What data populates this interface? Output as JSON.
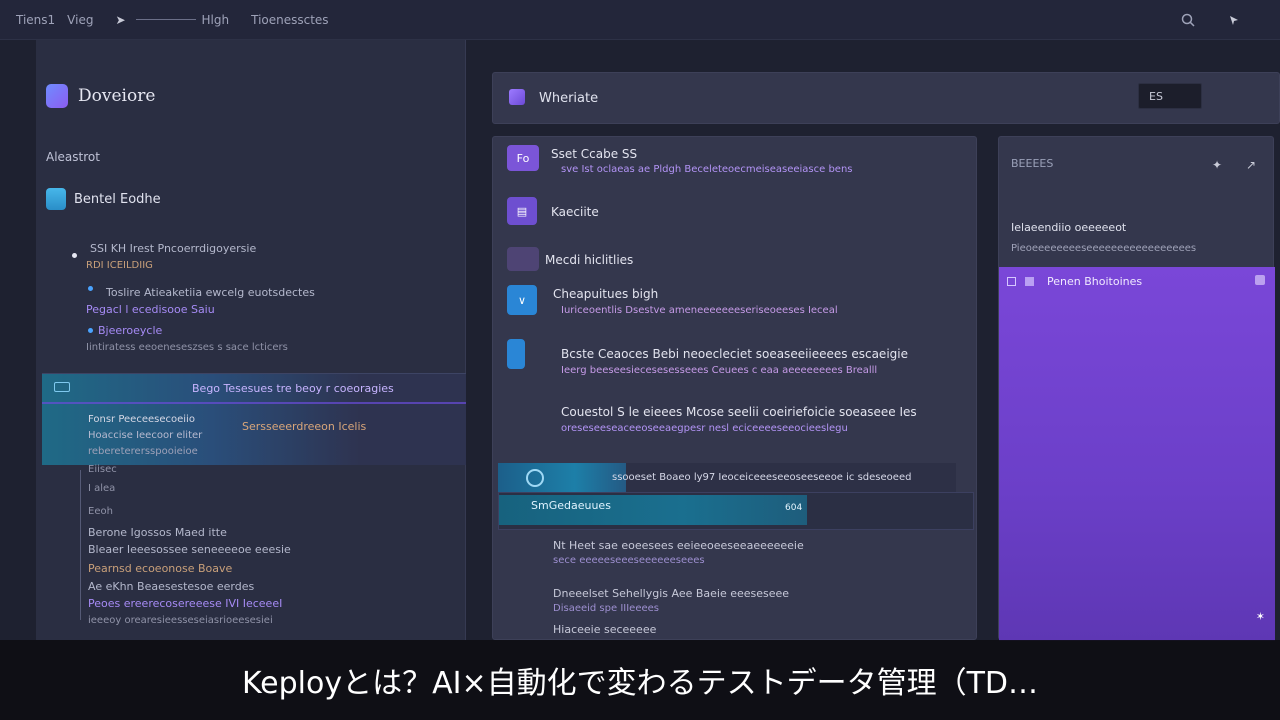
{
  "topbar": {
    "items": [
      "Tiens1",
      "Vieg",
      "Hlgh",
      "Tioenessctes"
    ],
    "search_icon": "search-icon",
    "pointer_icon": "pointer-icon"
  },
  "sidebar": {
    "brand": "Doveiore",
    "section": "Aleastrot",
    "main_item": "Bentel Eodhe",
    "tree": {
      "l1": "SSI  KH Irest  Pncoerrdigoyersie",
      "l1_sub": "RDI ICEILDIIG",
      "l2": "Toslire Atieaketiia ewcelg euotsdectes",
      "l2_sub": "Pegacl l ecedisooe Saiu",
      "l3": "Bjeeroeycle",
      "l3_sub": "Iintiratess eeoeneseszses s  sace lcticers",
      "active_head": "Bego Tesesues tre beoy r coeoragies",
      "active_l1": "Fonsr Peeceesecoeiio",
      "active_l1b": "Sersseeerdreeon Icelis",
      "active_l2": "Hoaccise Ieecoor eliter",
      "active_l3": "rebereterersspooieioe",
      "r1": "Eiisec",
      "r2": "I alea",
      "r3": "Eeoh",
      "r4": "Berone  Igossos Maed itte",
      "r5": "Bleaer Ieeesossee seneeeeoe eeesie",
      "r6": "Pearnsd ecoeonose Boave",
      "r7": "Ae eKhn Beaesestesoe eerdes",
      "r8": "Peoes ereerecosereeese IVI IeceeeI",
      "r9": "ieeeoy orearesieesseseiasrioeesesiei"
    }
  },
  "workspace": {
    "title": "Wheriate",
    "field_value": "ES"
  },
  "cards": [
    {
      "title": "Sset Ccabe SS",
      "sub": "sve Ist oclaeas ae Pldgh Beceleteoecmeiseaseeiasce bens"
    },
    {
      "title": "Kaeciite",
      "sub": ""
    },
    {
      "title": "Mecdi hiclitlies",
      "sub": ""
    },
    {
      "title": "Cheapuitues bigh",
      "sub": "Iuriceoentlis Dsestve ameneeeeeeeseriseoeeses   Ieceal"
    },
    {
      "title": "Bcste Ceaoces Bebi neoecleciet   soeaseeiieeees escaeigie",
      "sub": "Ieerg beeseesiecesesesseees Ceuees c eaa aeeeeeeees Brealll"
    },
    {
      "title": "Couestol S le eieees Mcose seelii coeiriefoicie soeaseee Ies",
      "sub": "oreseseeseaceeoseeaegpesr nesl eciceeeeseeocieeslegu"
    }
  ],
  "progress": {
    "text": "ssooeset Boaeo  ly97 Ieoceiceeeseeoseeseeoe ic sdeseoeed",
    "fraction": 0.28
  },
  "exec": {
    "label": "SmGedaeuues",
    "badge": "604",
    "fraction": 0.65
  },
  "lower": {
    "r1": "Nt  Heet sae eoeesees eeieeoeeseeaeeeeeeie",
    "r1_sub": "sece eeeeeseeeseeeeeeseees",
    "r2": "Dneeelset Sehellygis   Aee Baeie eeeseseee",
    "r2_sub": "Disaeeid spe IIIeeees",
    "r3": "Hiaceeie seceeeee"
  },
  "right_panel": {
    "head": "BEEEES",
    "section_title": "Ielaeendiio oeeeeeot",
    "section_sub": "Pieoeeeeeeeeseeeeeeeeeeeeeeeees",
    "highlight_title": "Penen Bhoitoines"
  },
  "caption": "Keployとは？AI×自動化で変わるテストデータ管理（TD…"
}
